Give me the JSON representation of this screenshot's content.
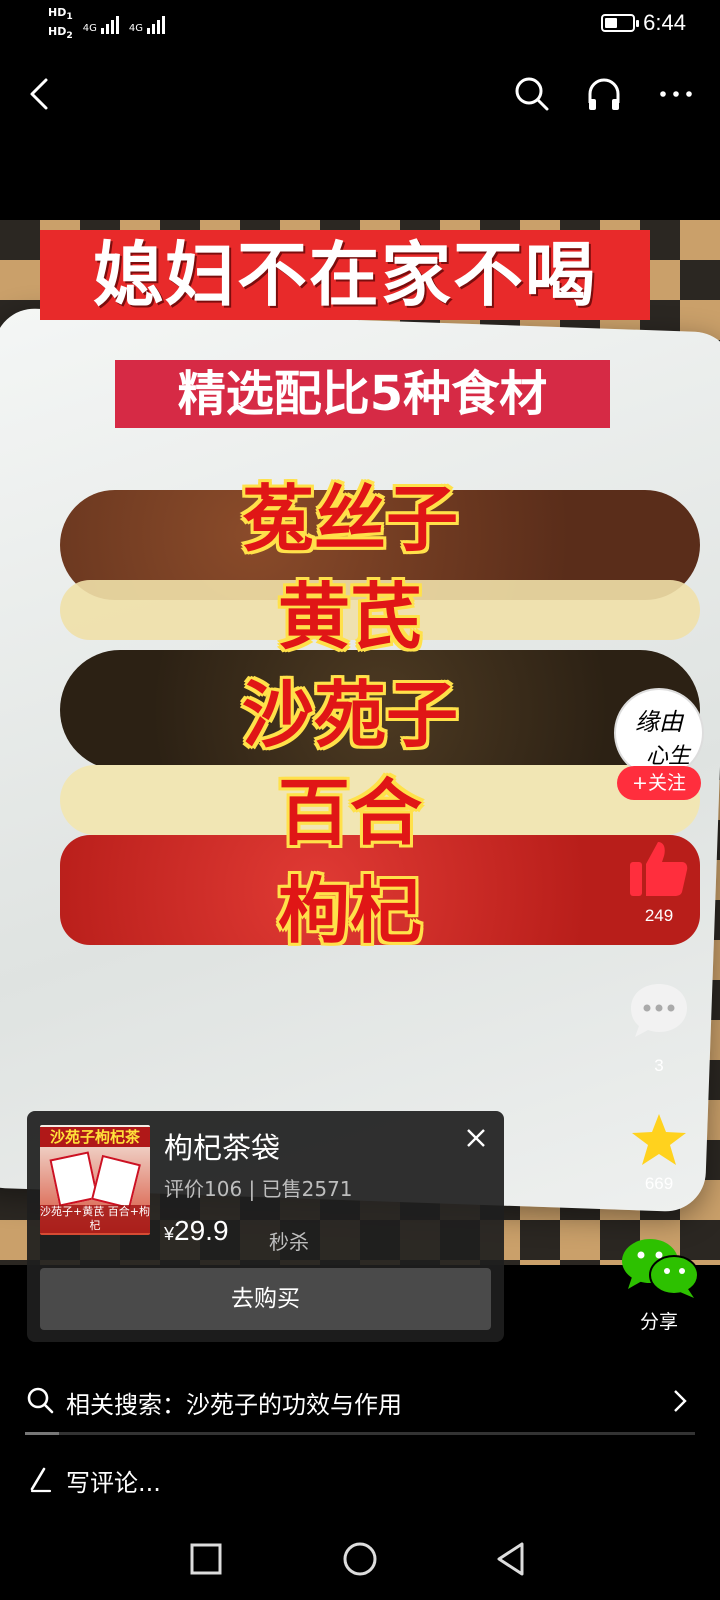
{
  "status_bar": {
    "hd1": "HD",
    "hd1_sub": "1",
    "hd2": "HD",
    "hd2_sub": "2",
    "net1": "4G",
    "net2": "4G",
    "time": "6:44"
  },
  "top_nav": {
    "icons": [
      "back-icon",
      "search-icon",
      "headset-icon",
      "more-icon"
    ]
  },
  "video": {
    "title": "媳妇不在家不喝",
    "subtitle": "精选配比5种食材",
    "ingredients": [
      "菟丝子",
      "黄芪",
      "沙苑子",
      "百合",
      "枸杞"
    ]
  },
  "creator": {
    "avatar_text_1": "缘由",
    "avatar_text_2": "心生",
    "follow_label": "+关注"
  },
  "actions": {
    "likes": "249",
    "comments": "3",
    "favorites": "669",
    "share_label": "分享"
  },
  "product": {
    "thumb_title": "沙苑子枸杞茶",
    "thumb_caption": "沙苑子+黄芪 百合+枸杞",
    "title": "枸杞茶袋",
    "meta": "评价106 | 已售2571",
    "currency": "¥",
    "price": "29.9",
    "tag": "秒杀",
    "buy_label": "去购买"
  },
  "related_search": {
    "text": "相关搜索：沙苑子的功效与作用"
  },
  "playback": {
    "progress_fraction": 0.05
  },
  "comment_input": {
    "placeholder": "写评论..."
  },
  "colors": {
    "accent_red": "#ff2e3d",
    "star_yellow": "#ffd21e",
    "share_green": "#2dc100"
  }
}
